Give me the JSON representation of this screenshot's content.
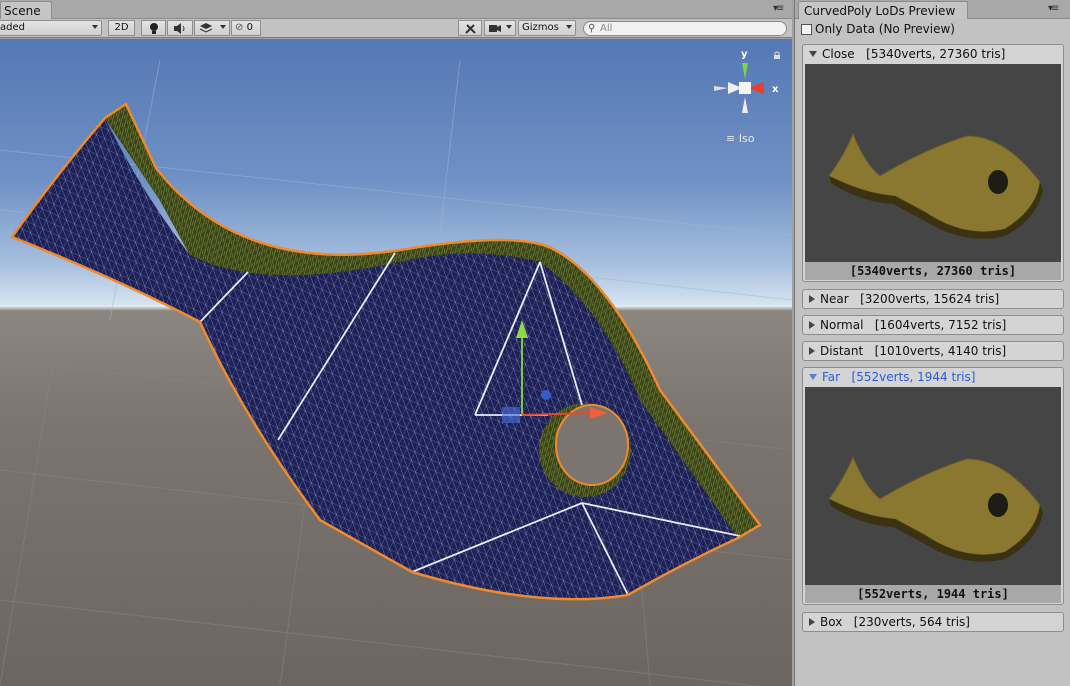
{
  "scene": {
    "tab_label": "Scene",
    "shading_mode": "aded",
    "btn_2d": "2D",
    "hidden_count": "0",
    "gizmos_label": "Gizmos",
    "search_placeholder": "All",
    "iso_label": "Iso",
    "axis_y": "y",
    "axis_x": "x"
  },
  "panel": {
    "tab_label": "CurvedPoly LoDs Preview",
    "only_data_label": "Only Data (No Preview)",
    "only_data_checked": false,
    "lods": [
      {
        "name": "Close",
        "info": "[5340verts, 27360 tris]",
        "expanded": true,
        "selected": false,
        "caption": "[5340verts, 27360 tris]"
      },
      {
        "name": "Near",
        "info": "[3200verts, 15624 tris]",
        "expanded": false,
        "selected": false
      },
      {
        "name": "Normal",
        "info": "[1604verts, 7152 tris]",
        "expanded": false,
        "selected": false
      },
      {
        "name": "Distant",
        "info": "[1010verts, 4140 tris]",
        "expanded": false,
        "selected": false
      },
      {
        "name": "Far",
        "info": "[552verts, 1944 tris]",
        "expanded": true,
        "selected": true,
        "caption": "[552verts, 1944 tris]"
      },
      {
        "name": "Box",
        "info": "[230verts, 564 tris]",
        "expanded": false,
        "selected": false
      }
    ]
  },
  "colors": {
    "mesh_fill": "#1d2157",
    "wire": "#d4dcf2",
    "outline": "#f08a2b",
    "rim": "#3a4a1a",
    "preview_fish": "#8a7830",
    "selected_text": "#2b5bd6"
  }
}
